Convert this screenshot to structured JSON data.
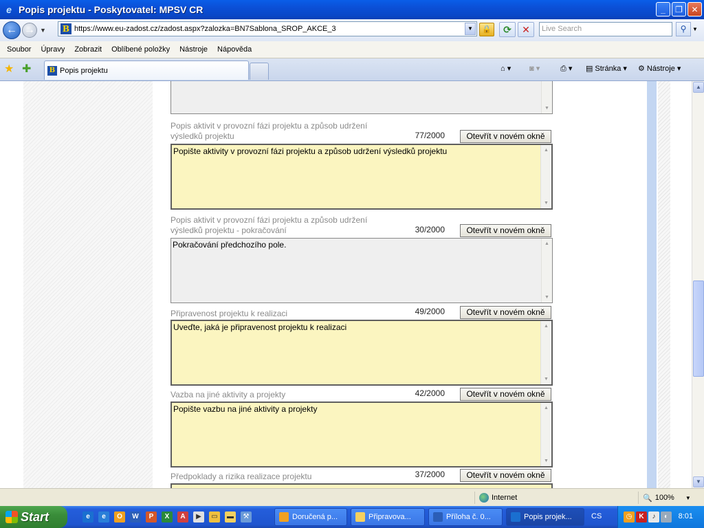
{
  "window": {
    "title": "Popis projektu - Poskytovatel: MPSV CR",
    "minimize": "_",
    "maximize": "❐",
    "close": "✕"
  },
  "address": {
    "url": "https://www.eu-zadost.cz/zadost.aspx?zalozka=BN7Sablona_SROP_AKCE_3",
    "search_placeholder": "Live Search"
  },
  "menu": [
    "Soubor",
    "Úpravy",
    "Zobrazit",
    "Oblíbené položky",
    "Nástroje",
    "Nápověda"
  ],
  "tab": {
    "label": "Popis projektu"
  },
  "commands": {
    "page": "Stránka",
    "tools": "Nástroje"
  },
  "open_button_label": "Otevřít v novém okně",
  "fields": [
    {
      "label": "Popis aktivit v provozní fázi projektu a způsob udržení výsledků projektu",
      "counter": "77/2000",
      "value": "Popište aktivity v provozní fázi projektu a způsob udržení výsledků projektu"
    },
    {
      "label": "Popis aktivit v provozní fázi projektu a způsob udržení výsledků projektu - pokračování",
      "counter": "30/2000",
      "value": "Pokračování předchozího pole."
    },
    {
      "label": "Připravenost projektu k realizaci",
      "counter": "49/2000",
      "value": "Uveďte, jaká je připravenost projektu k realizaci"
    },
    {
      "label": "Vazba na jiné aktivity a projekty",
      "counter": "42/2000",
      "value": "Popište vazbu na jiné aktivity a projekty"
    },
    {
      "label": "Předpoklady a rizika realizace projektu",
      "counter": "37/2000",
      "value": ""
    }
  ],
  "status": {
    "zone": "Internet",
    "zoom": "100%"
  },
  "taskbar": {
    "start": "Start",
    "tasks": [
      "Doručená p...",
      "Připravova...",
      "Příloha č. 0...",
      "Popis projek..."
    ],
    "lang": "CS",
    "clock": "8:01"
  },
  "colors": {
    "field_yellow": "#fbf5c0",
    "field_gray": "#efefef",
    "titlebar": "#0b4fd6"
  }
}
